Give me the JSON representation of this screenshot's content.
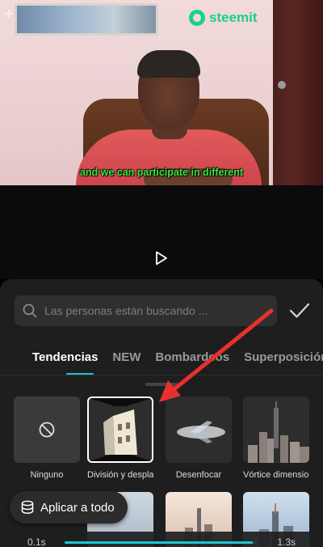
{
  "video": {
    "brand": "steemit",
    "subtitle": "and we can participate in different"
  },
  "search": {
    "placeholder": "Las personas están buscando ..."
  },
  "tabs": [
    {
      "label": "Tendencias",
      "active": true
    },
    {
      "label": "NEW",
      "active": false
    },
    {
      "label": "Bombardeos",
      "active": false
    },
    {
      "label": "Superposición",
      "active": false
    }
  ],
  "effects": [
    {
      "label": "Ninguno",
      "icon": "prohibited-icon"
    },
    {
      "label": "División y desplazamiento",
      "selected": true
    },
    {
      "label": "Desenfocar"
    },
    {
      "label": "Vórtice dimensional"
    }
  ],
  "apply_all": {
    "label": "Aplicar a todo",
    "icon": "layers-icon"
  },
  "duration": {
    "min": "0.1s",
    "max": "1.3s",
    "value_fraction": 0.98
  },
  "colors": {
    "accent": "#19c6d6",
    "brand": "#19d28a",
    "subtitle": "#3ee63a",
    "arrow": "#e8302c"
  }
}
